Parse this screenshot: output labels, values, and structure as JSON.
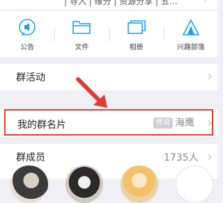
{
  "header": {
    "tags": "| 导入 | 缘分 | 资源分享 | 五…",
    "chevron": "›"
  },
  "toolbar": {
    "items": [
      {
        "label": "公告",
        "icon": "announcement-icon"
      },
      {
        "label": "文件",
        "icon": "folder-icon"
      },
      {
        "label": "相册",
        "icon": "album-icon"
      },
      {
        "label": "兴趣部落",
        "icon": "tent-icon"
      }
    ]
  },
  "rows": {
    "activity": {
      "title": "群活动",
      "chevron": "›"
    },
    "card": {
      "title": "我的群名片",
      "badge": "传说",
      "nickname": "海鹰",
      "chevron": "›"
    },
    "members": {
      "title": "群成员",
      "count": "1735人",
      "chevron": "›"
    }
  },
  "colors": {
    "accent": "#1aa0e8",
    "highlight": "#e53935"
  }
}
